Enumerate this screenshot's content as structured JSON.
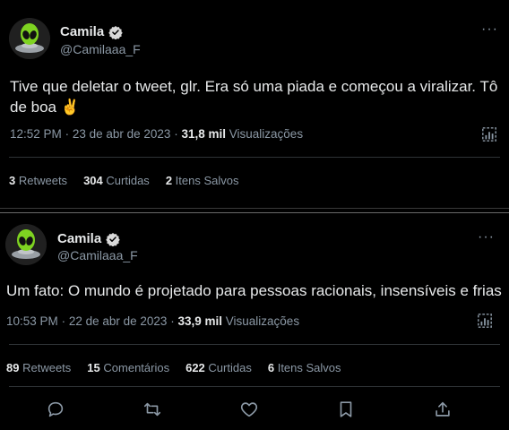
{
  "tweets": [
    {
      "author_name": "Camila",
      "handle": "@Camilaaa_F",
      "text": "Tive que deletar o tweet, glr. Era só uma piada e começou a viralizar. Tô de boa ✌️",
      "time": "12:52 PM",
      "date": "23 de abr de 2023",
      "views_count": "31,8 mil",
      "views_label": "Visualizações",
      "stats": [
        {
          "count": "3",
          "label": "Retweets"
        },
        {
          "count": "304",
          "label": "Curtidas"
        },
        {
          "count": "2",
          "label": "Itens Salvos"
        }
      ]
    },
    {
      "author_name": "Camila",
      "handle": "@Camilaaa_F",
      "text": "Um fato: O mundo é projetado para pessoas racionais, insensíveis e frias",
      "time": "10:53 PM",
      "date": "22 de abr de 2023",
      "views_count": "33,9 mil",
      "views_label": "Visualizações",
      "stats": [
        {
          "count": "89",
          "label": "Retweets"
        },
        {
          "count": "15",
          "label": "Comentários"
        },
        {
          "count": "622",
          "label": "Curtidas"
        },
        {
          "count": "6",
          "label": "Itens Salvos"
        }
      ]
    }
  ],
  "dot_separator": "·",
  "more_glyph": "···",
  "icons": [
    "alien-avatar",
    "verified-badge",
    "more-icon",
    "analytics-icon",
    "reply-icon",
    "retweet-icon",
    "like-icon",
    "bookmark-icon",
    "share-icon"
  ],
  "colors": {
    "background": "#000000",
    "text": "#e7e9ea",
    "muted": "#8b98a5",
    "divider": "#2f3336"
  }
}
